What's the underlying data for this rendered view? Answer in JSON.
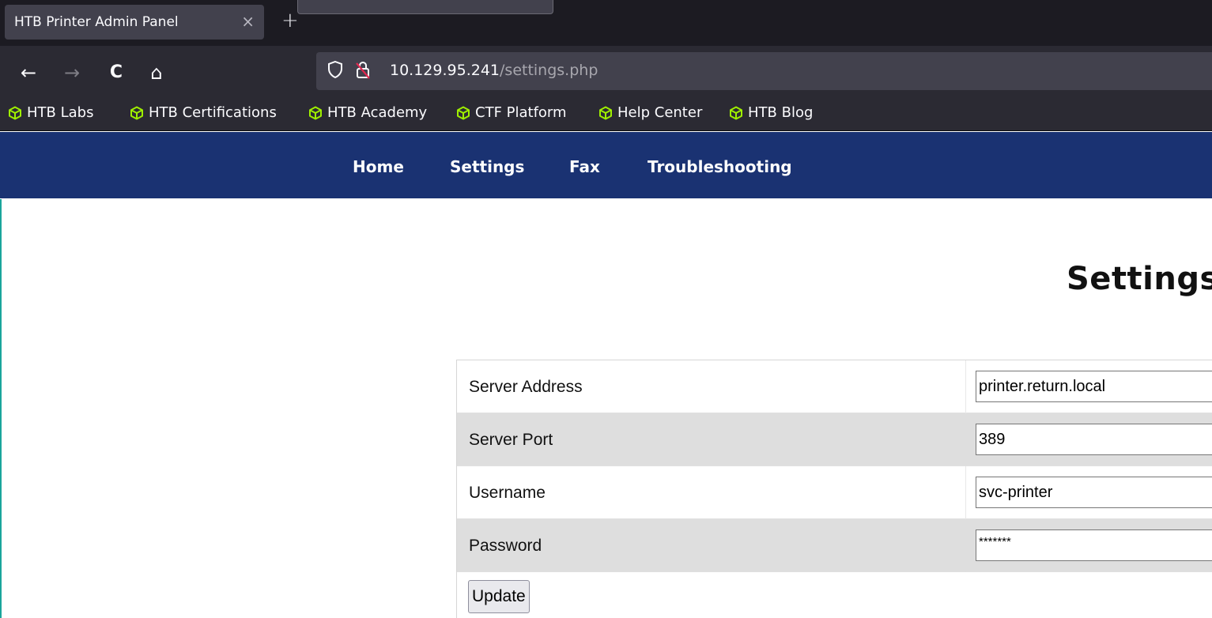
{
  "browser": {
    "tab_title": "HTB Printer Admin Panel",
    "tab_close": "×",
    "new_tab": "+",
    "nav": {
      "back": "←",
      "forward": "→",
      "reload": "C",
      "home": "⌂"
    },
    "url": {
      "host": "10.129.95.241",
      "path": "/settings.php"
    },
    "bookmarks": [
      {
        "label": "HTB Labs"
      },
      {
        "label": "HTB Certifications"
      },
      {
        "label": "HTB Academy"
      },
      {
        "label": "CTF Platform"
      },
      {
        "label": "Help Center"
      },
      {
        "label": "HTB Blog"
      }
    ],
    "bookmark_icon_color": "#9fef00"
  },
  "page": {
    "nav": [
      {
        "label": "Home"
      },
      {
        "label": "Settings"
      },
      {
        "label": "Fax"
      },
      {
        "label": "Troubleshooting"
      }
    ],
    "nav_color": "#1a3272",
    "heading": "Settings",
    "form": {
      "rows": [
        {
          "label": "Server Address",
          "value": "printer.return.local"
        },
        {
          "label": "Server Port",
          "value": "389"
        },
        {
          "label": "Username",
          "value": "svc-printer"
        },
        {
          "label": "Password",
          "value": "*******"
        }
      ],
      "submit_label": "Update"
    }
  }
}
